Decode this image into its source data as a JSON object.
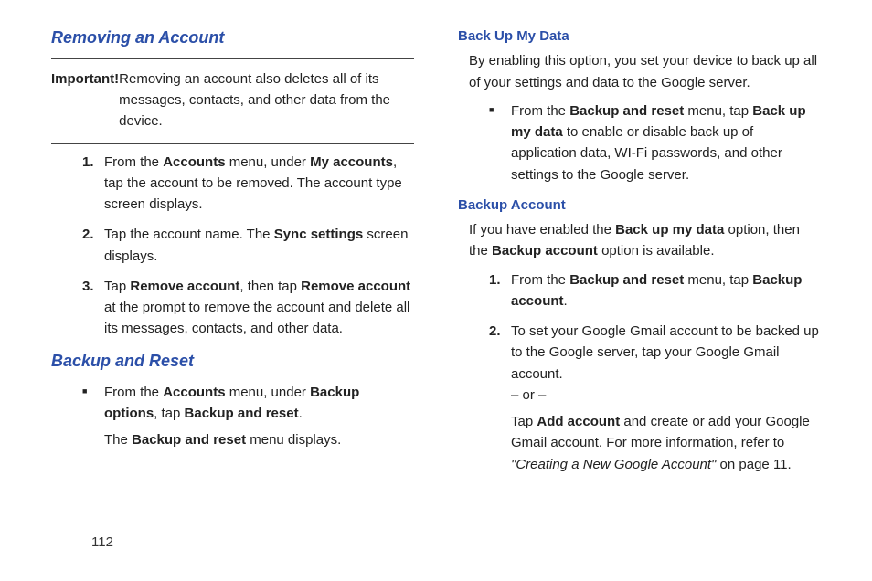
{
  "page_number": "112",
  "left": {
    "h1": "Removing an Account",
    "important": {
      "label": "Important!",
      "text": "Removing an account also deletes all of its messages, contacts, and other data from the device."
    },
    "steps": [
      {
        "pre1": "From the ",
        "b1": "Accounts",
        "mid1": " menu, under ",
        "b2": "My accounts",
        "post1": ", tap the account to be removed. The account type screen displays."
      },
      {
        "pre1": "Tap the account name. The ",
        "b1": "Sync settings",
        "post1": " screen displays."
      },
      {
        "pre1": "Tap ",
        "b1": "Remove account",
        "mid1": ", then tap ",
        "b2": "Remove account",
        "post1": " at the prompt to remove the account and delete all its messages, contacts, and other data."
      }
    ],
    "h2": "Backup and Reset",
    "bullet1": {
      "pre1": "From the ",
      "b1": "Accounts",
      "mid1": " menu, under ",
      "b2": "Backup options",
      "post1": ", tap ",
      "b3": "Backup and reset",
      "post2": ".",
      "line2_pre": "The ",
      "line2_b": "Backup and reset",
      "line2_post": " menu displays."
    }
  },
  "right": {
    "h1": "Back Up My Data",
    "intro1": "By enabling this option, you set your device to back up all of your settings and data to the Google server.",
    "bullet1": {
      "pre1": "From the ",
      "b1": "Backup and reset",
      "mid1": " menu, tap ",
      "b2": "Back up my data",
      "post1": " to enable or disable back up of application data, WI-Fi passwords, and other settings to the Google server."
    },
    "h2": "Backup Account",
    "intro2_pre": "If you have enabled the ",
    "intro2_b1": "Back up my data",
    "intro2_mid": " option, then the ",
    "intro2_b2": "Backup account",
    "intro2_post": " option is available.",
    "steps": [
      {
        "pre1": "From the ",
        "b1": "Backup and reset",
        "mid1": " menu, tap ",
        "b2": "Backup account",
        "post1": "."
      },
      {
        "pre1": "To set your Google Gmail account to be backed up to the Google server, tap your Google Gmail account.",
        "or": "– or –",
        "line3_pre": "Tap ",
        "line3_b": "Add account",
        "line3_mid": " and create or add your Google Gmail account. For more information, refer to ",
        "line3_ref": "\"Creating a New Google Account\"",
        "line3_post": "  on page 11."
      }
    ]
  }
}
